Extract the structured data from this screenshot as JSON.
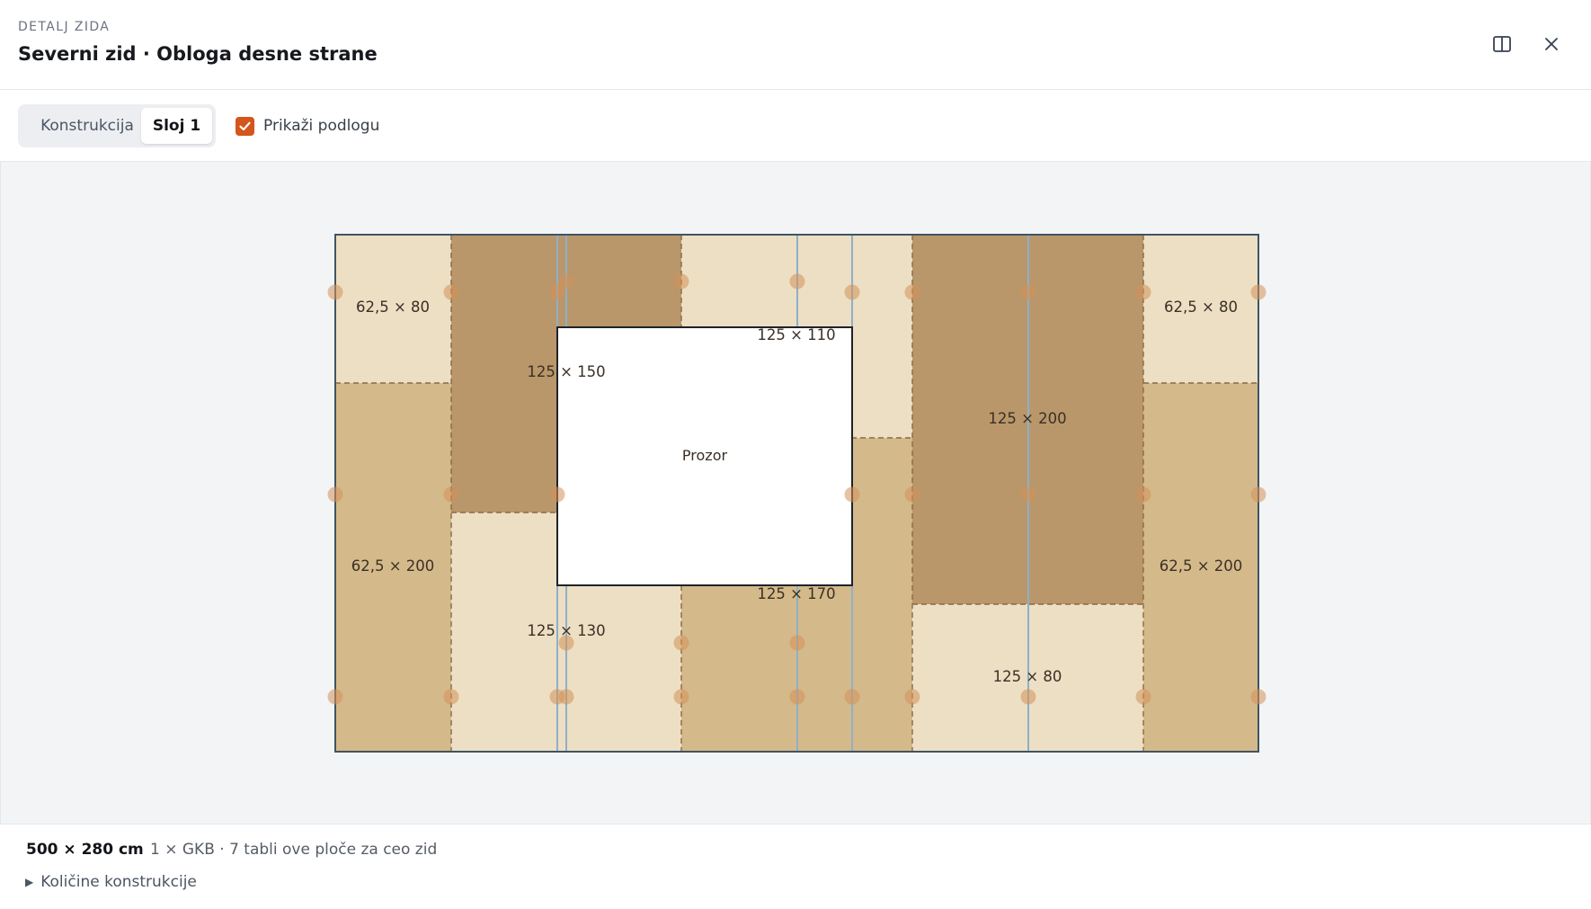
{
  "header": {
    "eyebrow": "DETALJ ZIDA",
    "title": "Severni zid · Obloga desne strane"
  },
  "toolbar": {
    "tabs": [
      {
        "label": "Konstrukcija",
        "active": false
      },
      {
        "label": "Sloj 1",
        "active": true
      }
    ],
    "checkbox": {
      "label": "Prikaži podlogu",
      "checked": true
    }
  },
  "drawing": {
    "opening_label": "Prozor",
    "panel_labels": [
      "62,5 × 80",
      "125 × 150",
      "125 × 110",
      "125 × 200",
      "62,5 × 80",
      "62,5 × 200",
      "125 × 130",
      "125 × 170",
      "125 × 80",
      "62,5 × 200"
    ]
  },
  "footer": {
    "dimensions": "500 × 280 cm",
    "spec": "1 × GKB · 7 tabli ove ploče za ceo zid",
    "quantities_toggle": "Količine konstrukcije"
  },
  "colors": {
    "accent": "#d4561c",
    "panel_light": "#ecdfc4",
    "panel_mid": "#d4b98a",
    "panel_dark": "#b9976a",
    "stud": "#8fb0c8",
    "outline": "#3f5563"
  }
}
